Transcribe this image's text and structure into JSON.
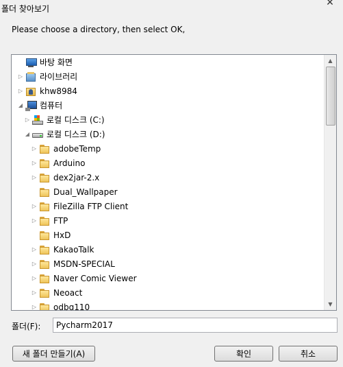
{
  "window": {
    "title": "폴더 찾아보기",
    "close_symbol": "✕"
  },
  "instruction": "Please choose a directory, then select OK,",
  "tree": {
    "items": [
      {
        "label": "바탕 화면",
        "icon": "desktop-icon",
        "arrow": ""
      },
      {
        "label": "라이브러리",
        "icon": "library-icon",
        "arrow": "▷"
      },
      {
        "label": "khw8984",
        "icon": "user-folder-icon",
        "arrow": "▷"
      },
      {
        "label": "컴퓨터",
        "icon": "computer-icon",
        "arrow": "◢"
      },
      {
        "label": "로컬 디스크 (C:)",
        "icon": "drive-c-icon",
        "arrow": "▷"
      },
      {
        "label": "로컬 디스크 (D:)",
        "icon": "drive-d-icon",
        "arrow": "◢"
      },
      {
        "label": "adobeTemp",
        "icon": "folder-icon",
        "arrow": "▷"
      },
      {
        "label": "Arduino",
        "icon": "folder-icon",
        "arrow": "▷"
      },
      {
        "label": "dex2jar-2.x",
        "icon": "folder-icon",
        "arrow": "▷"
      },
      {
        "label": "Dual_Wallpaper",
        "icon": "folder-icon",
        "arrow": ""
      },
      {
        "label": "FileZilla FTP Client",
        "icon": "folder-icon",
        "arrow": "▷"
      },
      {
        "label": "FTP",
        "icon": "folder-icon",
        "arrow": "▷"
      },
      {
        "label": "HxD",
        "icon": "folder-icon",
        "arrow": ""
      },
      {
        "label": "KakaoTalk",
        "icon": "folder-icon",
        "arrow": "▷"
      },
      {
        "label": "MSDN-SPECIAL",
        "icon": "folder-icon",
        "arrow": "▷"
      },
      {
        "label": "Naver Comic Viewer",
        "icon": "folder-icon",
        "arrow": "▷"
      },
      {
        "label": "Neoact",
        "icon": "folder-icon",
        "arrow": "▷"
      },
      {
        "label": "odbg110",
        "icon": "folder-icon",
        "arrow": "▷"
      }
    ]
  },
  "scrollbar": {
    "up_symbol": "▲",
    "down_symbol": "▼"
  },
  "folder_field": {
    "label": "폴더(F):",
    "value": "Pycharm2017"
  },
  "buttons": {
    "new_folder": "새 폴더 만들기(A)",
    "ok": "확인",
    "cancel": "취소"
  }
}
